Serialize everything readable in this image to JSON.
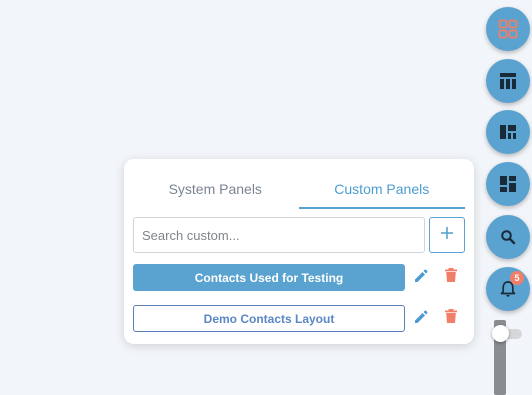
{
  "panel": {
    "tabs": [
      {
        "label": "System Panels",
        "active": false
      },
      {
        "label": "Custom Panels",
        "active": true
      }
    ],
    "search": {
      "placeholder": "Search custom...",
      "value": ""
    },
    "add_button": {
      "icon": "plus-icon"
    },
    "layouts": [
      {
        "label": "Contacts Used for Testing",
        "selected": true,
        "edit_icon": "pencil-icon",
        "delete_icon": "trash-icon"
      },
      {
        "label": "Demo Contacts Layout",
        "selected": false,
        "edit_icon": "pencil-icon",
        "delete_icon": "trash-icon"
      }
    ]
  },
  "rail": {
    "buttons": [
      {
        "icon": "grid-layout-icon"
      },
      {
        "icon": "table-layout-icon"
      },
      {
        "icon": "dashboard-layout-icon"
      },
      {
        "icon": "panels-layout-icon"
      },
      {
        "icon": "search-icon"
      },
      {
        "icon": "bell-icon",
        "badge": "5"
      }
    ]
  },
  "colors": {
    "accent": "#5aa2d0",
    "danger": "#f07f6a",
    "background": "#f2f5f9"
  }
}
